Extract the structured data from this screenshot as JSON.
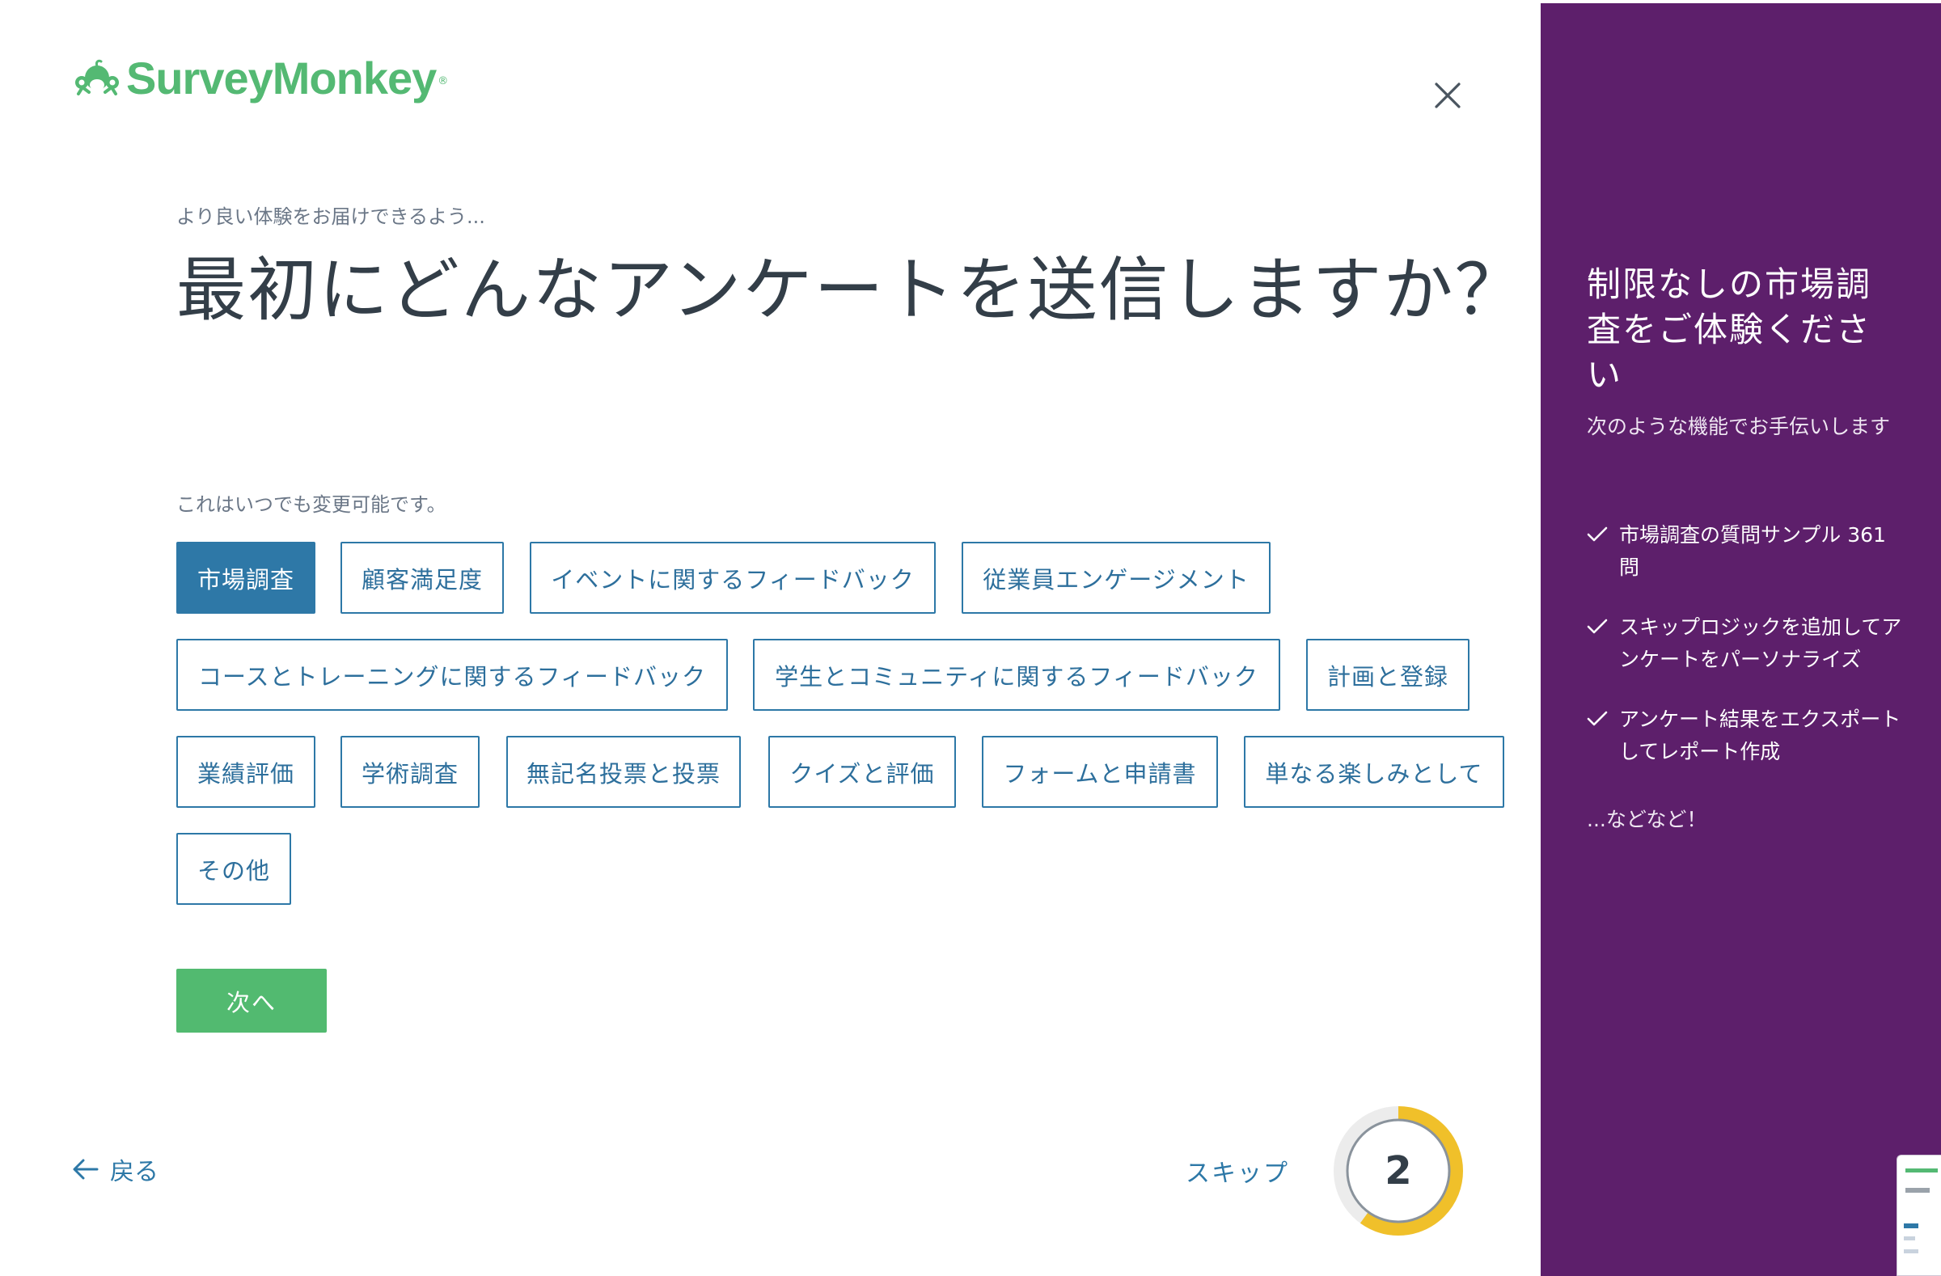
{
  "brand": {
    "name": "SurveyMonkey",
    "registered_mark": "®",
    "color": "#54b973"
  },
  "header": {
    "close_icon": "close-icon"
  },
  "question": {
    "eyebrow": "より良い体験をお届けできるよう...",
    "title": "最初にどんなアンケートを送信しますか？",
    "hint": "これはいつでも変更可能です。"
  },
  "options": [
    {
      "label": "市場調査",
      "selected": true
    },
    {
      "label": "顧客満足度",
      "selected": false
    },
    {
      "label": "イベントに関するフィードバック",
      "selected": false
    },
    {
      "label": "従業員エンゲージメント",
      "selected": false
    },
    {
      "label": "コースとトレーニングに関するフィードバック",
      "selected": false
    },
    {
      "label": "学生とコミュニティに関するフィードバック",
      "selected": false
    },
    {
      "label": "計画と登録",
      "selected": false
    },
    {
      "label": "業績評価",
      "selected": false
    },
    {
      "label": "学術調査",
      "selected": false
    },
    {
      "label": "無記名投票と投票",
      "selected": false
    },
    {
      "label": "クイズと評価",
      "selected": false
    },
    {
      "label": "フォームと申請書",
      "selected": false
    },
    {
      "label": "単なる楽しみとして",
      "selected": false
    },
    {
      "label": "その他",
      "selected": false
    }
  ],
  "actions": {
    "next_label": "次へ",
    "back_label": "戻る",
    "skip_label": "スキップ"
  },
  "progress": {
    "step": "2",
    "fraction": 0.6,
    "accent": "#f0c02a"
  },
  "sidebar": {
    "background": "#5d1f6b",
    "title": "制限なしの市場調査をご体験ください",
    "subtitle": "次のような機能でお手伝いします",
    "features": [
      "市場調査の質問サンプル 361 問",
      "スキップロジックを追加してアンケートをパーソナライズ",
      "アンケート結果をエクスポートしてレポート作成"
    ],
    "more": "...などなど！"
  },
  "colors": {
    "primary_blue": "#2e78a7",
    "next_green": "#52ba70",
    "heading": "#333e48"
  }
}
